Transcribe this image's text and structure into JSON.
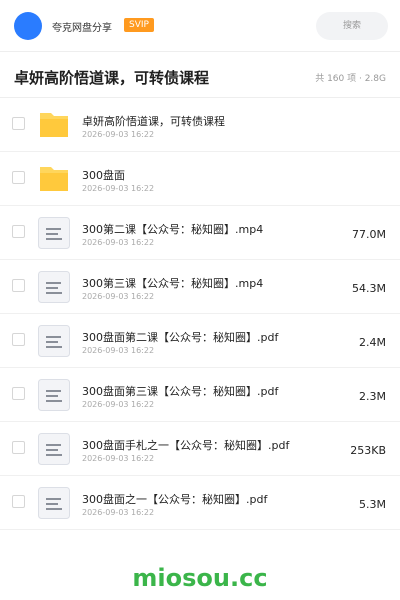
{
  "header": {
    "brand": "夸克网盘分享",
    "badge": "SVIP",
    "search_placeholder": "搜索"
  },
  "folder": {
    "title": "卓妍高阶悟道课，可转债课程",
    "meta": "共 160 项 · 2.8G"
  },
  "files": [
    {
      "type": "folder",
      "name": "卓妍高阶悟道课，可转债课程",
      "date": "2026-09-03 16:22",
      "size": ""
    },
    {
      "type": "folder",
      "name": "300盘面",
      "date": "2026-09-03 16:22",
      "size": ""
    },
    {
      "type": "file",
      "name": "300第二课【公众号：秘知圈】.mp4",
      "date": "2026-09-03 16:22",
      "size": "77.0M"
    },
    {
      "type": "file",
      "name": "300第三课【公众号：秘知圈】.mp4",
      "date": "2026-09-03 16:22",
      "size": "54.3M"
    },
    {
      "type": "file",
      "name": "300盘面第二课【公众号：秘知圈】.pdf",
      "date": "2026-09-03 16:22",
      "size": "2.4M"
    },
    {
      "type": "file",
      "name": "300盘面第三课【公众号：秘知圈】.pdf",
      "date": "2026-09-03 16:22",
      "size": "2.3M"
    },
    {
      "type": "file",
      "name": "300盘面手札之一【公众号：秘知圈】.pdf",
      "date": "2026-09-03 16:22",
      "size": "253KB"
    },
    {
      "type": "file",
      "name": "300盘面之一【公众号：秘知圈】.pdf",
      "date": "2026-09-03 16:22",
      "size": "5.3M"
    }
  ],
  "watermark": "miosou.cc",
  "colors": {
    "accent": "#2a7cff",
    "badge": "#ff9a1f",
    "folder": "#ffc93c",
    "watermark": "#3bb54a"
  }
}
